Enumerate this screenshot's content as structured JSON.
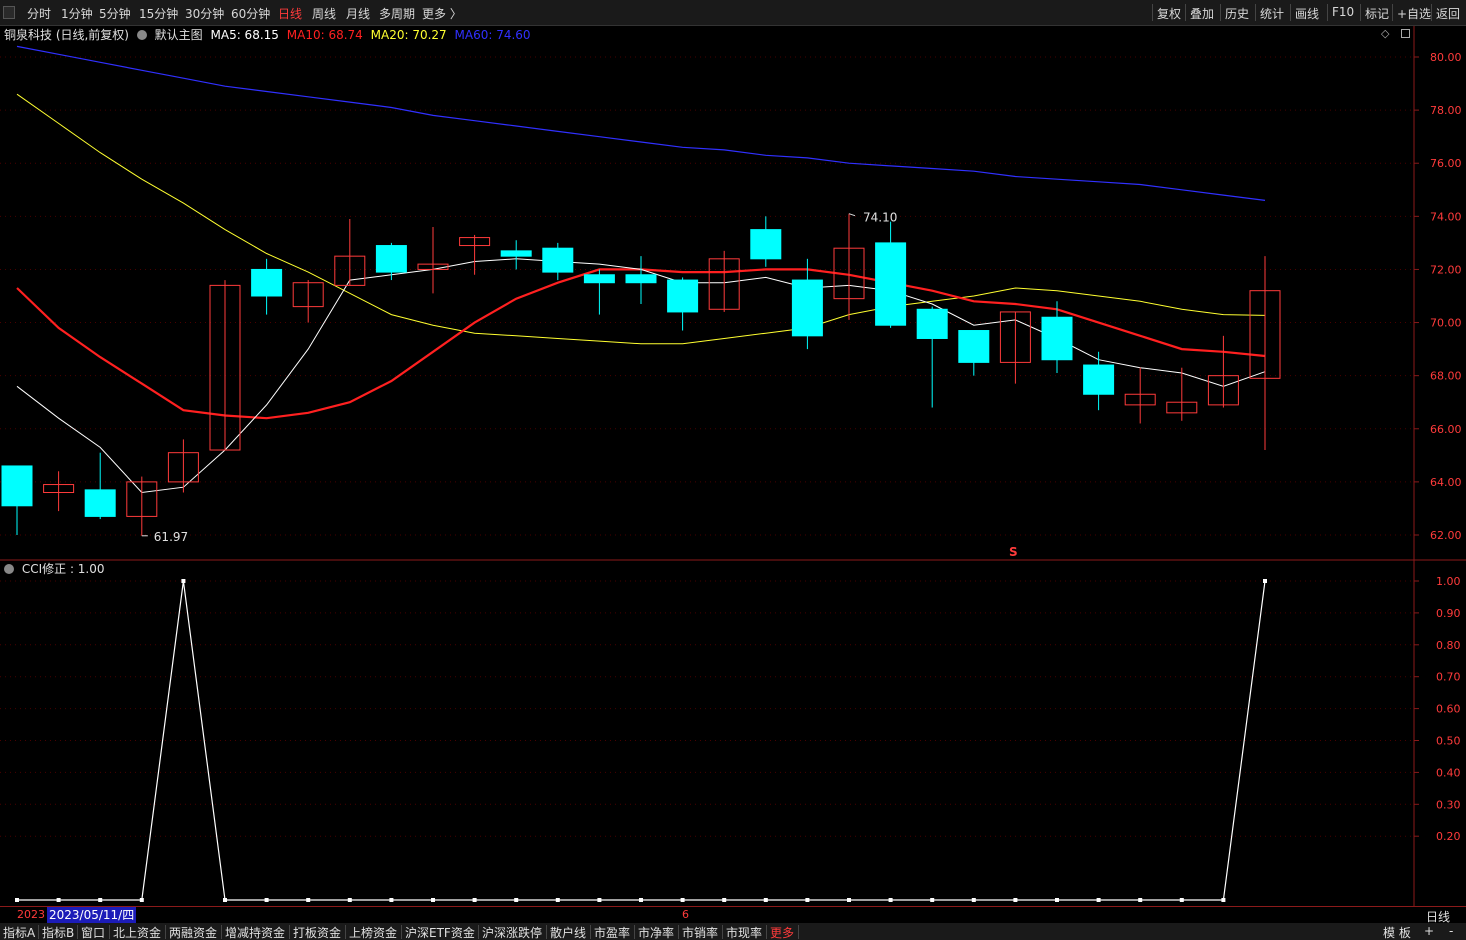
{
  "toolbar": {
    "left_items": [
      {
        "label": "分时",
        "active": false
      },
      {
        "label": "1分钟",
        "active": false
      },
      {
        "label": "5分钟",
        "active": false
      },
      {
        "label": "15分钟",
        "active": false
      },
      {
        "label": "30分钟",
        "active": false
      },
      {
        "label": "60分钟",
        "active": false
      },
      {
        "label": "日线",
        "active": true
      },
      {
        "label": "周线",
        "active": false
      },
      {
        "label": "月线",
        "active": false
      },
      {
        "label": "多周期",
        "active": false
      },
      {
        "label": "更多 〉",
        "active": false
      }
    ],
    "right_items": [
      "复权",
      "叠加",
      "历史",
      "统计",
      "画线",
      "F10",
      "标记",
      "+自选",
      "返回"
    ]
  },
  "main_legend": {
    "stock": "铜泉科技 (日线,前复权)",
    "template": "默认主图",
    "ma5": "MA5: 68.15",
    "ma10": "MA10: 68.74",
    "ma20": "MA20: 70.27",
    "ma60": "MA60: 74.60"
  },
  "sub_legend": {
    "text": "CCI修正 : 1.00"
  },
  "annotations": {
    "high_label": "74.10",
    "low_label": "61.97",
    "marker": "S"
  },
  "colors": {
    "up": "#ff3b3b",
    "down": "#00ffff",
    "ma5": "#ffffff",
    "ma10": "#ff2020",
    "ma20": "#ffff30",
    "ma60": "#3030ff",
    "cci": "#ffffff",
    "axis": "#8b1a1a",
    "grid": "#4a0000"
  },
  "datebar": {
    "year": "2023",
    "date": "2023/05/11/四",
    "month": "6",
    "period": "日线"
  },
  "tabs": [
    {
      "label": "指标A",
      "active": false
    },
    {
      "label": "指标B",
      "active": false
    },
    {
      "label": "窗口",
      "active": false
    },
    {
      "label": "北上资金",
      "active": false
    },
    {
      "label": "两融资金",
      "active": false
    },
    {
      "label": "增减持资金",
      "active": false
    },
    {
      "label": "打板资金",
      "active": false
    },
    {
      "label": "上榜资金",
      "active": false
    },
    {
      "label": "沪深ETF资金",
      "active": false
    },
    {
      "label": "沪深涨跌停",
      "active": false
    },
    {
      "label": "散户线",
      "active": false
    },
    {
      "label": "市盈率",
      "active": false
    },
    {
      "label": "市净率",
      "active": false
    },
    {
      "label": "市销率",
      "active": false
    },
    {
      "label": "市现率",
      "active": false
    },
    {
      "label": "更多",
      "active": true
    }
  ],
  "tab_right": [
    "模 板",
    "+",
    "-"
  ],
  "chart_data": [
    {
      "type": "candlestick",
      "title": "铜泉科技 (日线,前复权)",
      "ylim": [
        61.5,
        81
      ],
      "yticks": [
        "80.00",
        "78.00",
        "76.00",
        "74.00",
        "72.00",
        "70.00",
        "68.00",
        "66.00",
        "64.00",
        "62.00"
      ],
      "candles": [
        {
          "o": 64.6,
          "h": 64.6,
          "l": 62.0,
          "c": 63.1
        },
        {
          "o": 63.6,
          "h": 64.4,
          "l": 62.9,
          "c": 63.9
        },
        {
          "o": 63.7,
          "h": 65.1,
          "l": 62.6,
          "c": 62.7
        },
        {
          "o": 62.7,
          "h": 64.2,
          "l": 61.97,
          "c": 64.0
        },
        {
          "o": 64.0,
          "h": 65.6,
          "l": 63.6,
          "c": 65.1
        },
        {
          "o": 65.2,
          "h": 71.6,
          "l": 65.2,
          "c": 71.4
        },
        {
          "o": 72.0,
          "h": 72.4,
          "l": 70.3,
          "c": 71.0
        },
        {
          "o": 70.6,
          "h": 71.6,
          "l": 70.0,
          "c": 71.5
        },
        {
          "o": 71.4,
          "h": 73.9,
          "l": 71.4,
          "c": 72.5
        },
        {
          "o": 72.9,
          "h": 73.0,
          "l": 71.6,
          "c": 71.9
        },
        {
          "o": 72.0,
          "h": 73.6,
          "l": 71.1,
          "c": 72.2
        },
        {
          "o": 72.9,
          "h": 73.3,
          "l": 71.8,
          "c": 73.2
        },
        {
          "o": 72.7,
          "h": 73.1,
          "l": 72.0,
          "c": 72.5
        },
        {
          "o": 72.8,
          "h": 73.0,
          "l": 71.6,
          "c": 71.9
        },
        {
          "o": 71.8,
          "h": 72.0,
          "l": 70.3,
          "c": 71.5
        },
        {
          "o": 71.8,
          "h": 72.5,
          "l": 70.7,
          "c": 71.5
        },
        {
          "o": 71.6,
          "h": 71.7,
          "l": 69.7,
          "c": 70.4
        },
        {
          "o": 70.5,
          "h": 72.7,
          "l": 70.4,
          "c": 72.4
        },
        {
          "o": 73.5,
          "h": 74.0,
          "l": 72.1,
          "c": 72.4
        },
        {
          "o": 71.6,
          "h": 72.4,
          "l": 69.0,
          "c": 69.5
        },
        {
          "o": 70.9,
          "h": 74.1,
          "l": 70.1,
          "c": 72.8
        },
        {
          "o": 73.0,
          "h": 73.8,
          "l": 69.8,
          "c": 69.9
        },
        {
          "o": 70.5,
          "h": 70.6,
          "l": 66.8,
          "c": 69.4
        },
        {
          "o": 69.7,
          "h": 69.7,
          "l": 68.0,
          "c": 68.5
        },
        {
          "o": 68.5,
          "h": 70.4,
          "l": 67.7,
          "c": 70.4
        },
        {
          "o": 70.2,
          "h": 70.8,
          "l": 68.1,
          "c": 68.6
        },
        {
          "o": 68.4,
          "h": 68.9,
          "l": 66.7,
          "c": 67.3
        },
        {
          "o": 66.9,
          "h": 68.3,
          "l": 66.2,
          "c": 67.3
        },
        {
          "o": 66.6,
          "h": 68.3,
          "l": 66.3,
          "c": 67.0
        },
        {
          "o": 66.9,
          "h": 69.5,
          "l": 66.8,
          "c": 68.0
        },
        {
          "o": 67.9,
          "h": 72.5,
          "l": 65.2,
          "c": 71.2
        }
      ],
      "series": [
        {
          "name": "MA5",
          "values": [
            67.6,
            66.4,
            65.3,
            63.6,
            63.8,
            65.2,
            66.9,
            69.0,
            71.6,
            71.8,
            72.0,
            72.3,
            72.4,
            72.3,
            72.2,
            72.0,
            71.5,
            71.5,
            71.7,
            71.3,
            71.4,
            71.2,
            70.7,
            69.9,
            70.1,
            69.4,
            68.6,
            68.3,
            68.1,
            67.6,
            68.15
          ]
        },
        {
          "name": "MA10",
          "values": [
            71.3,
            69.8,
            68.7,
            67.7,
            66.7,
            66.5,
            66.4,
            66.6,
            67.0,
            67.8,
            68.9,
            70.0,
            70.9,
            71.5,
            72.0,
            72.0,
            71.9,
            71.9,
            72.0,
            72.0,
            71.8,
            71.5,
            71.2,
            70.8,
            70.7,
            70.5,
            70.0,
            69.5,
            69.0,
            68.9,
            68.74
          ]
        },
        {
          "name": "MA20",
          "values": [
            78.6,
            77.5,
            76.4,
            75.4,
            74.5,
            73.5,
            72.6,
            71.9,
            71.1,
            70.3,
            69.9,
            69.6,
            69.5,
            69.4,
            69.3,
            69.2,
            69.2,
            69.4,
            69.6,
            69.8,
            70.3,
            70.6,
            70.8,
            71.0,
            71.3,
            71.2,
            71.0,
            70.8,
            70.5,
            70.3,
            70.27
          ]
        },
        {
          "name": "MA60",
          "values": [
            80.4,
            80.1,
            79.8,
            79.5,
            79.2,
            78.9,
            78.7,
            78.5,
            78.3,
            78.1,
            77.8,
            77.6,
            77.4,
            77.2,
            77.0,
            76.8,
            76.6,
            76.5,
            76.3,
            76.2,
            76.0,
            75.9,
            75.8,
            75.7,
            75.5,
            75.4,
            75.3,
            75.2,
            75.0,
            74.8,
            74.6
          ]
        }
      ]
    },
    {
      "type": "line",
      "title": "CCI修正 : 1.00",
      "ylim": [
        0,
        1.04
      ],
      "yticks": [
        "1.00",
        "0.90",
        "0.80",
        "0.70",
        "0.60",
        "0.50",
        "0.40",
        "0.30",
        "0.20"
      ],
      "series": [
        {
          "name": "CCI修正",
          "values": [
            0,
            0,
            0,
            0,
            1,
            0,
            0,
            0,
            0,
            0,
            0,
            0,
            0,
            0,
            0,
            0,
            0,
            0,
            0,
            0,
            0,
            0,
            0,
            0,
            0,
            0,
            0,
            0,
            0,
            0,
            1
          ]
        }
      ]
    }
  ]
}
